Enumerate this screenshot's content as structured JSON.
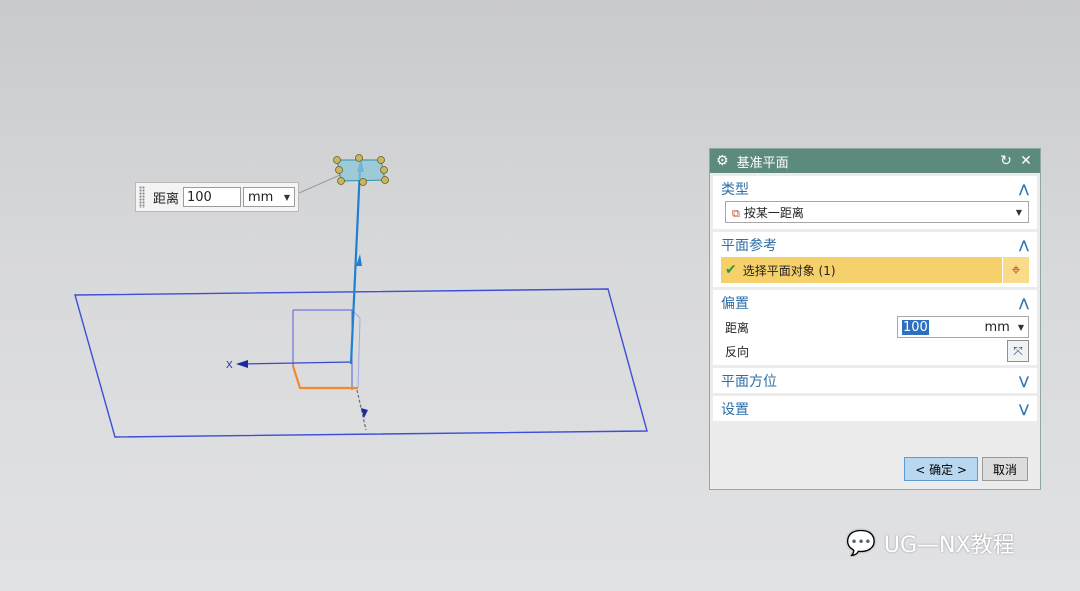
{
  "canvas": {
    "axis_x_label": "X",
    "distance_label": "距离",
    "distance_value": "100",
    "distance_unit": "mm"
  },
  "dialog": {
    "title": "基准平面",
    "sections": {
      "type": {
        "header": "类型",
        "selected": "按某一距离"
      },
      "plane_ref": {
        "header": "平面参考",
        "select_text": "选择平面对象 (1)"
      },
      "offset": {
        "header": "偏置",
        "distance_label": "距离",
        "distance_value": "100",
        "distance_unit": "mm",
        "reverse_label": "反向"
      },
      "orientation": {
        "header": "平面方位"
      },
      "settings": {
        "header": "设置"
      }
    },
    "ok_label": "< 确定 >",
    "cancel_label": "取消"
  },
  "watermark": {
    "text": "UG—NX教程"
  },
  "colors": {
    "title_bar": "#5d8a7e",
    "section_header_text": "#2e6fa8",
    "selection_bar": "#f6d06a",
    "plane_outline": "#3d4fd6",
    "normal_vector": "#1f7fd0"
  },
  "icons": {
    "title": "gear-icon",
    "reset": "reset-icon",
    "close": "close-icon",
    "expand": "chevron-up-icon",
    "collapse": "chevron-down-icon",
    "check": "check-icon",
    "target": "crosshair-icon",
    "flip": "flip-direction-icon"
  }
}
